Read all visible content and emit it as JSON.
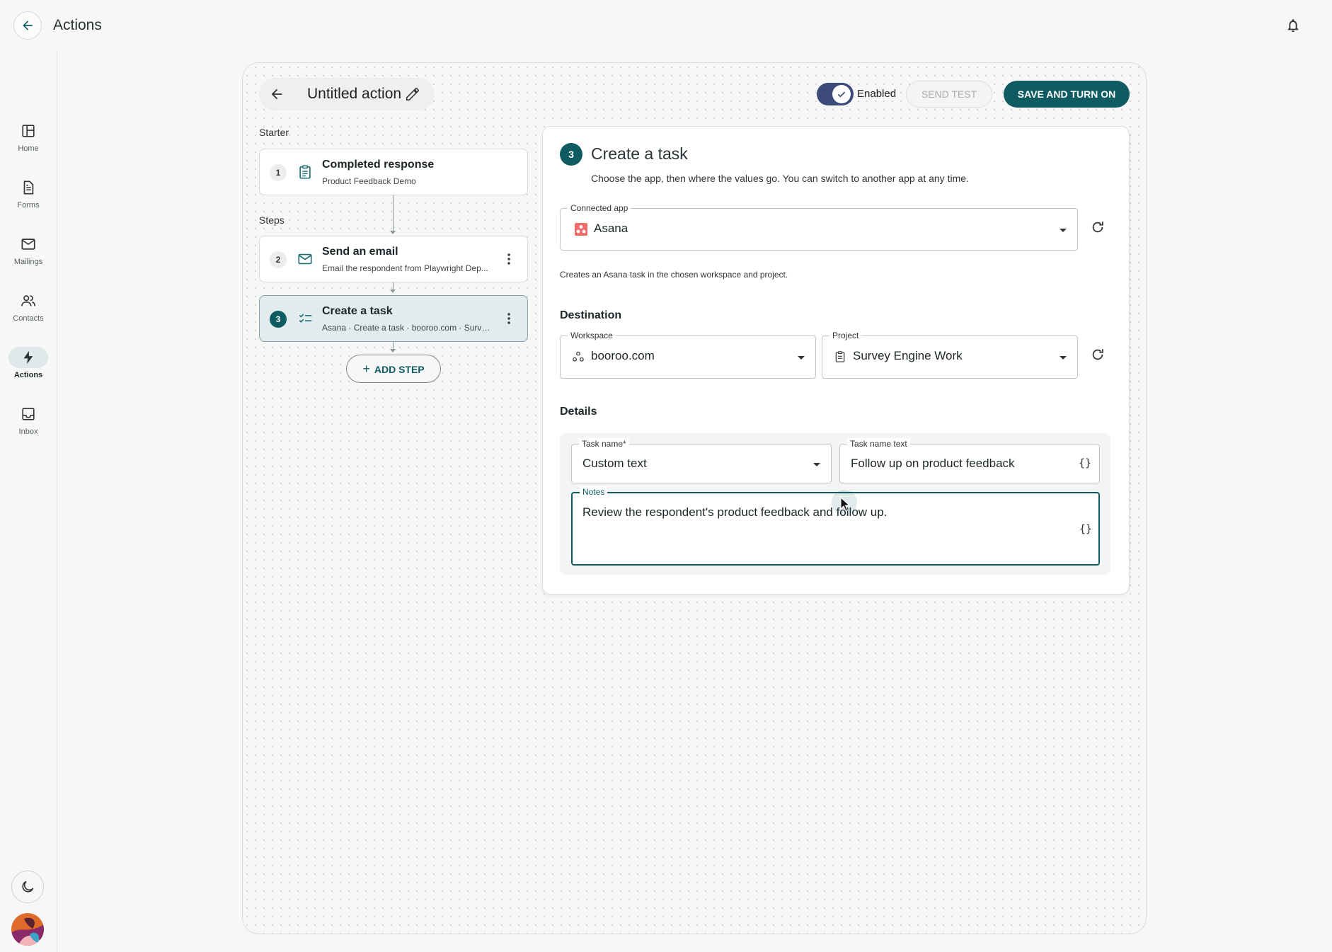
{
  "topbar": {
    "title": "Actions"
  },
  "sidebar": {
    "items": [
      {
        "label": "Home",
        "icon": "home-icon",
        "active": false
      },
      {
        "label": "Forms",
        "icon": "forms-icon",
        "active": false
      },
      {
        "label": "Mailings",
        "icon": "mail-icon",
        "active": false
      },
      {
        "label": "Contacts",
        "icon": "contacts-icon",
        "active": false
      },
      {
        "label": "Actions",
        "icon": "bolt-icon",
        "active": true
      },
      {
        "label": "Inbox",
        "icon": "inbox-icon",
        "active": false
      }
    ]
  },
  "editor": {
    "action_title": "Untitled action",
    "toggle_label": "Enabled",
    "toggle_on": true,
    "send_test_label": "SEND TEST",
    "save_label": "SAVE AND TURN ON",
    "starter_label": "Starter",
    "steps_label": "Steps",
    "steps": [
      {
        "num": "1",
        "title": "Completed response",
        "subtitle": "Product Feedback Demo",
        "icon": "clipboard-icon"
      },
      {
        "num": "2",
        "title": "Send an email",
        "subtitle": "Email the respondent from Playwright Dep...",
        "icon": "mail-icon"
      },
      {
        "num": "3",
        "title": "Create a task",
        "subtitle": "Asana · Create a task · booroo.com · Surve...",
        "icon": "checklist-icon"
      }
    ],
    "add_step_label": "ADD STEP"
  },
  "panel": {
    "step_num": "3",
    "title": "Create a task",
    "description": "Choose the app, then where the values go. You can switch to another app at any time.",
    "connected_app": {
      "label": "Connected app",
      "value": "Asana"
    },
    "helper": "Creates an Asana task in the chosen workspace and project.",
    "destination_heading": "Destination",
    "workspace": {
      "label": "Workspace",
      "value": "booroo.com"
    },
    "project": {
      "label": "Project",
      "value": "Survey Engine Work"
    },
    "details_heading": "Details",
    "task_name": {
      "label": "Task name*",
      "value": "Custom text"
    },
    "task_name_text": {
      "label": "Task name text",
      "value": "Follow up on product feedback"
    },
    "notes": {
      "label": "Notes",
      "value": "Review the respondent's product feedback and follow up."
    }
  },
  "colors": {
    "primary": "#0e5b62",
    "toggle": "#3b4a7a",
    "asana": "#f06a6a"
  }
}
